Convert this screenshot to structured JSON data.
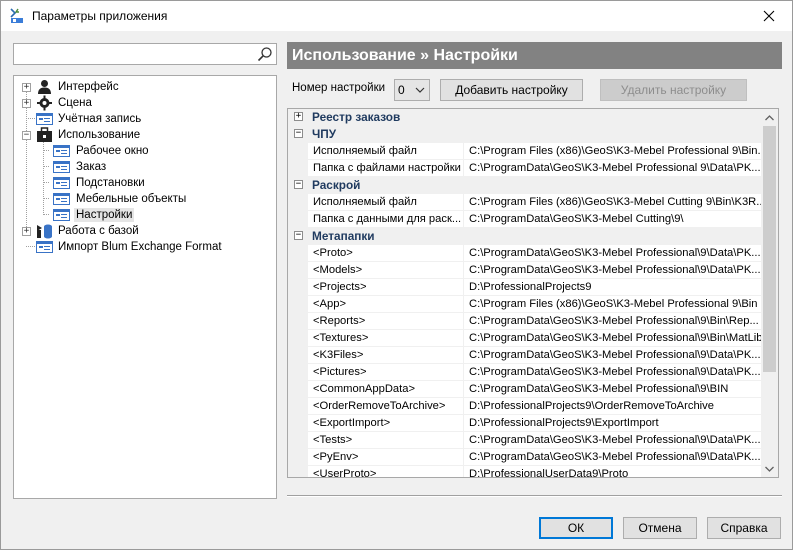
{
  "window": {
    "title": "Параметры приложения"
  },
  "search": {
    "value": "",
    "placeholder": ""
  },
  "tree": {
    "items": [
      {
        "label": "Интерфейс"
      },
      {
        "label": "Сцена"
      },
      {
        "label": "Учётная запись"
      },
      {
        "label": "Использование"
      },
      {
        "label": "Рабочее окно"
      },
      {
        "label": "Заказ"
      },
      {
        "label": "Подстановки"
      },
      {
        "label": "Мебельные объекты"
      },
      {
        "label": "Настройки"
      },
      {
        "label": "Работа с базой"
      },
      {
        "label": "Импорт Blum Exchange Format"
      }
    ]
  },
  "header": {
    "title": "Использование » Настройки"
  },
  "config": {
    "label": "Номер настройки",
    "selected": "0",
    "add_label": "Добавить настройку",
    "delete_label": "Удалить настройку"
  },
  "grid": {
    "categories": [
      {
        "name": "Реестр заказов",
        "expander": "+"
      },
      {
        "name": "ЧПУ",
        "expander": "−"
      },
      {
        "name": "Раскрой",
        "expander": "−"
      },
      {
        "name": "Метапапки",
        "expander": "−"
      }
    ],
    "props": [
      {
        "name": "Исполняемый файл",
        "value": "C:\\Program Files (x86)\\GeoS\\K3-Mebel Professional 9\\Bin..."
      },
      {
        "name": "Папка с файлами настройки",
        "value": "C:\\ProgramData\\GeoS\\K3-Mebel Professional 9\\Data\\PK..."
      },
      {
        "name": "Исполняемый файл",
        "value": "C:\\Program Files (x86)\\GeoS\\K3-Mebel Cutting 9\\Bin\\K3R..."
      },
      {
        "name": "Папка с данными для раск...",
        "value": "C:\\ProgramData\\GeoS\\K3-Mebel Cutting\\9\\"
      },
      {
        "name": "<Proto>",
        "value": "C:\\ProgramData\\GeoS\\K3-Mebel Professional\\9\\Data\\PK..."
      },
      {
        "name": "<Models>",
        "value": "C:\\ProgramData\\GeoS\\K3-Mebel Professional\\9\\Data\\PK..."
      },
      {
        "name": "<Projects>",
        "value": "D:\\ProfessionalProjects9"
      },
      {
        "name": "<App>",
        "value": "C:\\Program Files (x86)\\GeoS\\K3-Mebel Professional 9\\Bin"
      },
      {
        "name": "<Reports>",
        "value": "C:\\ProgramData\\GeoS\\K3-Mebel Professional\\9\\Bin\\Rep..."
      },
      {
        "name": "<Textures>",
        "value": "C:\\ProgramData\\GeoS\\K3-Mebel Professional\\9\\Bin\\MatLib"
      },
      {
        "name": "<K3Files>",
        "value": "C:\\ProgramData\\GeoS\\K3-Mebel Professional\\9\\Data\\PK..."
      },
      {
        "name": "<Pictures>",
        "value": "C:\\ProgramData\\GeoS\\K3-Mebel Professional\\9\\Data\\PK..."
      },
      {
        "name": "<CommonAppData>",
        "value": "C:\\ProgramData\\GeoS\\K3-Mebel Professional\\9\\BIN"
      },
      {
        "name": "<OrderRemoveToArchive>",
        "value": "D:\\ProfessionalProjects9\\OrderRemoveToArchive"
      },
      {
        "name": "<ExportImport>",
        "value": "D:\\ProfessionalProjects9\\ExportImport"
      },
      {
        "name": "<Tests>",
        "value": "C:\\ProgramData\\GeoS\\K3-Mebel Professional\\9\\Data\\PK..."
      },
      {
        "name": "<PyEnv>",
        "value": "C:\\ProgramData\\GeoS\\K3-Mebel Professional\\9\\Data\\PK..."
      },
      {
        "name": "<UserProto>",
        "value": "D:\\ProfessionalUserData9\\Proto"
      }
    ]
  },
  "footer": {
    "ok_label": "ОК",
    "cancel_label": "Отмена",
    "help_label": "Справка"
  },
  "colors": {
    "header_bg": "#828282",
    "accent": "#0078d7",
    "category_text": "#1f3a5f"
  },
  "icons": [
    "app-icon",
    "close-icon",
    "search-icon",
    "user-icon",
    "gear-icon",
    "window-icon",
    "briefcase-icon",
    "database-icon",
    "chevron-down-icon",
    "scroll-up-icon",
    "scroll-down-icon"
  ]
}
